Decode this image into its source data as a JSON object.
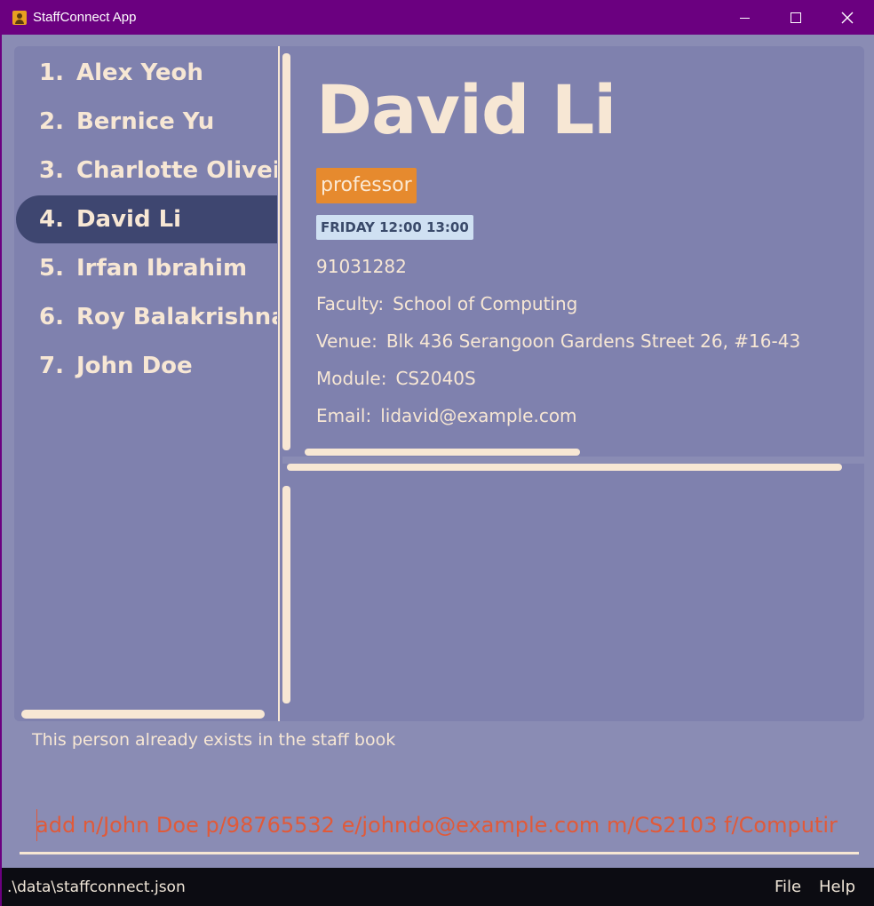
{
  "window": {
    "title": "StaffConnect App"
  },
  "icons": {
    "app": "staff-contact-icon",
    "minimize": "minimize-icon",
    "maximize": "maximize-icon",
    "close": "close-icon"
  },
  "colors": {
    "titlebar": "#6b0080",
    "panel": "#7f81ae",
    "selected": "#3e4670",
    "accent_text": "#f7e7d4",
    "role_tag": "#e68a2e",
    "schedule_tag": "#cfe0f2",
    "command_text": "#e05a3a",
    "statusbar": "#0c0c12"
  },
  "people": [
    {
      "index": "1.",
      "name": "Alex Yeoh"
    },
    {
      "index": "2.",
      "name": "Bernice Yu"
    },
    {
      "index": "3.",
      "name": "Charlotte Oliveiro"
    },
    {
      "index": "4.",
      "name": "David Li",
      "selected": true
    },
    {
      "index": "5.",
      "name": "Irfan Ibrahim"
    },
    {
      "index": "6.",
      "name": "Roy Balakrishnan"
    },
    {
      "index": "7.",
      "name": "John Doe"
    }
  ],
  "detail": {
    "name": "David Li",
    "role": "professor",
    "schedule": "FRIDAY 12:00 13:00",
    "phone": "91031282",
    "faculty_label": "Faculty:",
    "faculty": "School of Computing",
    "venue_label": "Venue:",
    "venue": "Blk 436 Serangoon Gardens Street 26, #16-43",
    "module_label": "Module:",
    "module": "CS2040S",
    "email_label": "Email:",
    "email": "lidavid@example.com"
  },
  "result": {
    "message": "This person already exists in the staff book"
  },
  "command": {
    "value": "add n/John Doe p/98765532 e/johndo@example.com m/CS2103 f/Computir"
  },
  "status": {
    "path": ".\\data\\staffconnect.json"
  },
  "menu": {
    "file": "File",
    "help": "Help"
  }
}
